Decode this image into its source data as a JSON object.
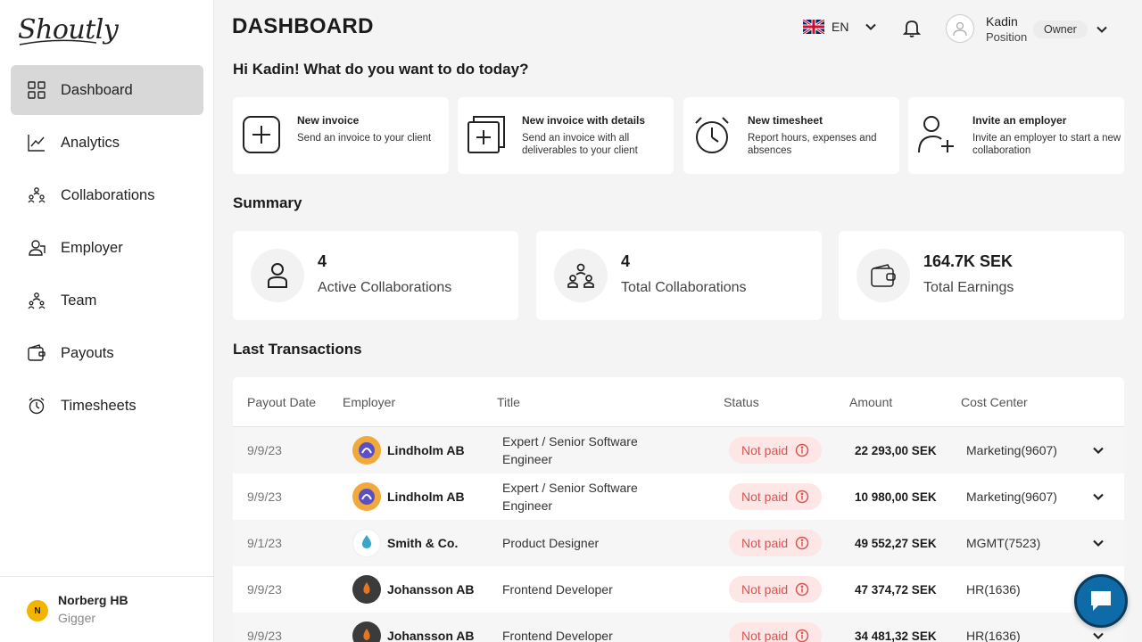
{
  "brand": {
    "logo_text": "Shoutly"
  },
  "sidebar": {
    "items": [
      {
        "label": "Dashboard",
        "icon": "grid-icon",
        "active": true
      },
      {
        "label": "Analytics",
        "icon": "chart-line-icon",
        "active": false
      },
      {
        "label": "Collaborations",
        "icon": "people-network-icon",
        "active": false
      },
      {
        "label": "Employer",
        "icon": "user-card-icon",
        "active": false
      },
      {
        "label": "Team",
        "icon": "team-icon",
        "active": false
      },
      {
        "label": "Payouts",
        "icon": "wallet-icon",
        "active": false
      },
      {
        "label": "Timesheets",
        "icon": "stopwatch-icon",
        "active": false
      }
    ],
    "footer": {
      "company": "Norberg HB",
      "role": "Gigger",
      "logo_letter": "N"
    }
  },
  "header": {
    "title": "DASHBOARD",
    "language": "EN",
    "user": {
      "name": "Kadin",
      "position": "Position",
      "role": "Owner"
    }
  },
  "greeting": "Hi Kadin! What do you want to do today?",
  "quick_actions": [
    {
      "title": "New invoice",
      "desc": "Send an invoice to your client",
      "icon": "plus-square-icon"
    },
    {
      "title": "New invoice with details",
      "desc": "Send an invoice with all deliverables to your client",
      "icon": "plus-stack-icon"
    },
    {
      "title": "New timesheet",
      "desc": "Report hours, expenses and absences",
      "icon": "stopwatch-icon"
    },
    {
      "title": "Invite an employer",
      "desc": "Invite an employer to start a new collaboration",
      "icon": "user-plus-icon"
    }
  ],
  "summary": {
    "title": "Summary",
    "cards": [
      {
        "value": "4",
        "label": "Active Collaborations",
        "icon": "person-icon"
      },
      {
        "value": "4",
        "label": "Total Collaborations",
        "icon": "people-network-icon"
      },
      {
        "value": "164.7K SEK",
        "label": "Total Earnings",
        "icon": "wallet-icon"
      }
    ]
  },
  "transactions": {
    "title": "Last Transactions",
    "columns": [
      "Payout Date",
      "Employer",
      "Title",
      "Status",
      "Amount",
      "Cost Center"
    ],
    "rows": [
      {
        "date": "9/9/23",
        "employer": "Lindholm AB",
        "title": "Expert / Senior Software Engineer",
        "status": "Not paid",
        "amount": "22 293,00 SEK",
        "cost_center": "Marketing(9607)",
        "logo_color": "#f2a93b"
      },
      {
        "date": "9/9/23",
        "employer": "Lindholm AB",
        "title": "Expert / Senior Software Engineer",
        "status": "Not paid",
        "amount": "10 980,00 SEK",
        "cost_center": "Marketing(9607)",
        "logo_color": "#f2a93b"
      },
      {
        "date": "9/1/23",
        "employer": "Smith & Co.",
        "title": "Product Designer",
        "status": "Not paid",
        "amount": "49 552,27 SEK",
        "cost_center": "MGMT(7523)",
        "logo_color": "#ffffff"
      },
      {
        "date": "9/9/23",
        "employer": "Johansson AB",
        "title": "Frontend Developer",
        "status": "Not paid",
        "amount": "47 374,72 SEK",
        "cost_center": "HR(1636)",
        "logo_color": "#3b3b3b"
      },
      {
        "date": "9/9/23",
        "employer": "Johansson AB",
        "title": "Frontend Developer",
        "status": "Not paid",
        "amount": "34 481,32 SEK",
        "cost_center": "HR(1636)",
        "logo_color": "#3b3b3b"
      }
    ]
  },
  "colors": {
    "active_nav": "#d8d8d8",
    "status_bg": "#fde6e6",
    "status_text": "#d9534f",
    "chat_button": "#0e6ba8"
  }
}
